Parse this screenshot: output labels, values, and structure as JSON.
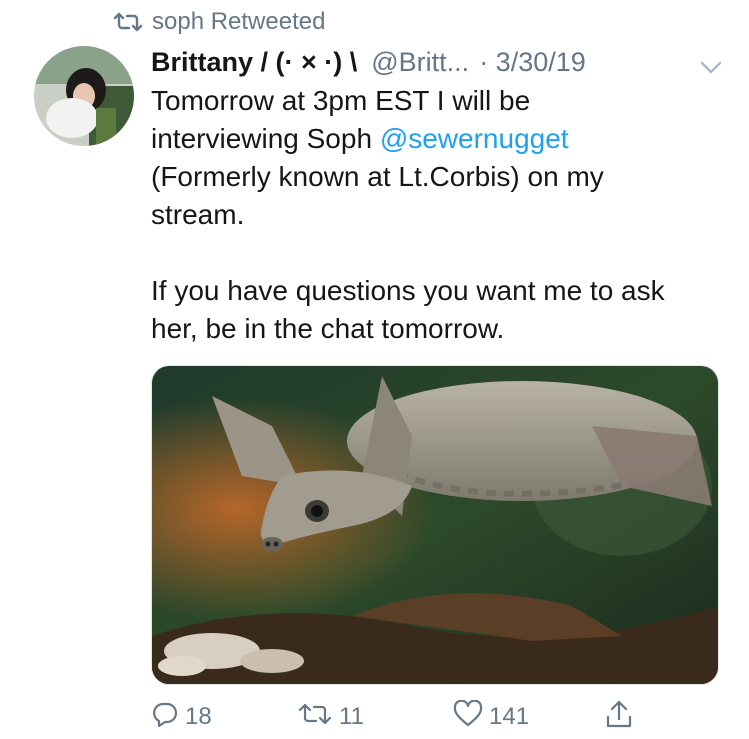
{
  "retweet": {
    "label": "soph Retweeted"
  },
  "tweet": {
    "display_name": "Brittany / (· × ·) \\",
    "handle": "@Britt...",
    "date": "· 3/30/19",
    "text": {
      "line1": "Tomorrow at 3pm EST I will be",
      "line2_prefix": "interviewing Soph ",
      "mention": "@sewernugget",
      "line3": "(Formerly known at Lt.Corbis) on my",
      "line4": "stream.",
      "line5": "If you have questions you want me to ask",
      "line6": "her, be in the chat tomorrow."
    },
    "media_icon": "turtle-photo"
  },
  "actions": {
    "reply_count": "18",
    "retweet_count": "11",
    "like_count": "141"
  },
  "icons": {
    "retweet": "retweet-icon",
    "caret": "chevron-down-icon",
    "reply": "reply-icon",
    "like": "heart-icon",
    "share": "share-icon"
  },
  "colors": {
    "accent": "#1da1f2",
    "secondary_text": "#657786",
    "primary_text": "#14171a"
  }
}
